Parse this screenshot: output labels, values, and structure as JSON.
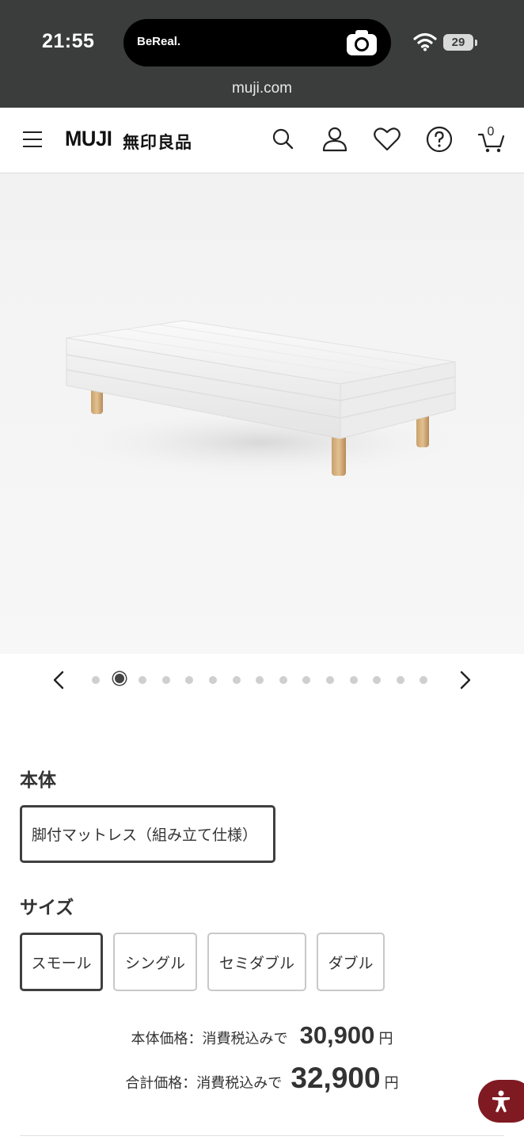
{
  "status_bar": {
    "time": "21:55",
    "island_app": "BeReal.",
    "battery": "29"
  },
  "browser": {
    "url": "muji.com"
  },
  "header": {
    "logo_en": "MUJI",
    "logo_ja": "無印良品",
    "cart_count": "0",
    "icons": [
      "menu-icon",
      "search-icon",
      "account-icon",
      "heart-icon",
      "help-icon",
      "cart-icon"
    ]
  },
  "carousel": {
    "image_count": 15,
    "active_index": 1
  },
  "options": {
    "body": {
      "title": "本体",
      "choices": [
        {
          "label": "脚付マットレス（組み立て仕様）",
          "selected": true
        }
      ]
    },
    "size": {
      "title": "サイズ",
      "choices": [
        {
          "label": "スモール",
          "selected": true
        },
        {
          "label": "シングル",
          "selected": false
        },
        {
          "label": "セミダブル",
          "selected": false
        },
        {
          "label": "ダブル",
          "selected": false
        }
      ]
    }
  },
  "pricing": {
    "body_price_label": "本体価格：消費税込みで",
    "body_price": "30,900",
    "total_price_label": "合計価格：消費税込みで",
    "total_price": "32,900",
    "currency": "円"
  },
  "colors": {
    "status_bar_bg": "#3a3d3c",
    "accessibility_button": "#7f1a22",
    "selected_border": "#3f3f3f"
  }
}
